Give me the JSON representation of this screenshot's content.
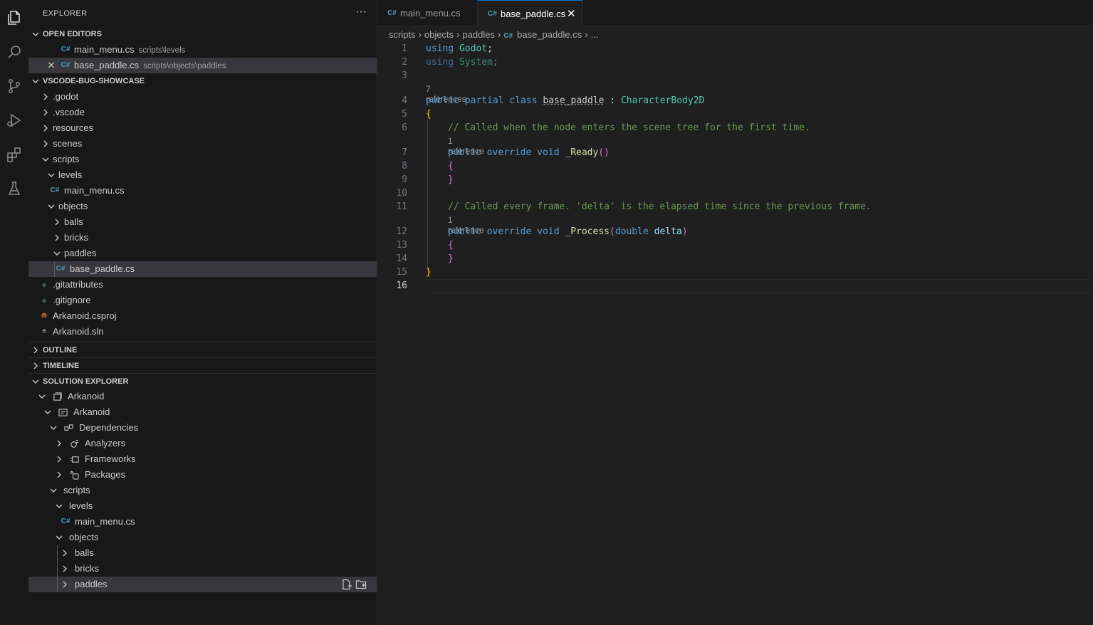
{
  "activity_bar": {
    "icons": [
      "explorer-icon",
      "search-icon",
      "source-control-icon",
      "run-debug-icon",
      "extensions-icon",
      "testing-icon"
    ]
  },
  "sidebar": {
    "title": "EXPLORER",
    "more": "···",
    "open_editors": {
      "header": "OPEN EDITORS",
      "items": [
        {
          "name": "main_menu.cs",
          "path": "scripts\\levels"
        },
        {
          "name": "base_paddle.cs",
          "path": "scripts\\objects\\paddles"
        }
      ]
    },
    "workspace": {
      "header": "VSCODE-BUG-SHOWCASE",
      "items": [
        {
          "label": ".godot"
        },
        {
          "label": ".vscode"
        },
        {
          "label": "resources"
        },
        {
          "label": "scenes"
        },
        {
          "label": "scripts"
        },
        {
          "label": "levels"
        },
        {
          "label": "main_menu.cs"
        },
        {
          "label": "objects"
        },
        {
          "label": "balls"
        },
        {
          "label": "bricks"
        },
        {
          "label": "paddles"
        },
        {
          "label": "base_paddle.cs"
        },
        {
          "label": ".gitattributes"
        },
        {
          "label": ".gitignore"
        },
        {
          "label": "Arkanoid.csproj"
        },
        {
          "label": "Arkanoid.sln"
        }
      ]
    },
    "outline_header": "OUTLINE",
    "timeline_header": "TIMELINE",
    "solution_explorer": {
      "header": "SOLUTION EXPLORER",
      "items": [
        {
          "label": "Arkanoid"
        },
        {
          "label": "Arkanoid"
        },
        {
          "label": "Dependencies"
        },
        {
          "label": "Analyzers"
        },
        {
          "label": "Frameworks"
        },
        {
          "label": "Packages"
        },
        {
          "label": "scripts"
        },
        {
          "label": "levels"
        },
        {
          "label": "main_menu.cs"
        },
        {
          "label": "objects"
        },
        {
          "label": "balls"
        },
        {
          "label": "bricks"
        },
        {
          "label": "paddles"
        }
      ]
    }
  },
  "editor": {
    "tabs": [
      {
        "label": "main_menu.cs",
        "active": false
      },
      {
        "label": "base_paddle.cs",
        "active": true
      }
    ],
    "breadcrumb": [
      "scripts",
      "objects",
      "paddles",
      "base_paddle.cs",
      "..."
    ],
    "line_numbers": [
      "1",
      "2",
      "3",
      "4",
      "5",
      "6",
      "7",
      "8",
      "9",
      "10",
      "11",
      "12",
      "13",
      "14",
      "15",
      "16"
    ],
    "code_lens": [
      "7 references",
      "1 reference",
      "1 reference"
    ],
    "code": {
      "l1_kw": "using",
      "l1_ns": "Godot",
      "l1_end": ";",
      "l2_kw": "using",
      "l2_ns": "System",
      "l2_end": ";",
      "l4_mods": "public partial class",
      "l4_name": "base_paddle",
      "l4_colon": " : ",
      "l4_base": "CharacterBody2D",
      "l5": "{",
      "l6": "// Called when the node enters the scene tree for the first time.",
      "l7_mods": "public override void",
      "l7_fn": "_Ready",
      "l7_paren": "()",
      "l8": "{",
      "l9": "}",
      "l11": "// Called every frame. 'delta' is the elapsed time since the previous frame.",
      "l12_mods": "public override void",
      "l12_fn": "_Process",
      "l12_open": "(",
      "l12_type": "double",
      "l12_param": " delta",
      "l12_close": ")",
      "l13": "{",
      "l14": "}",
      "l15": "}"
    }
  }
}
